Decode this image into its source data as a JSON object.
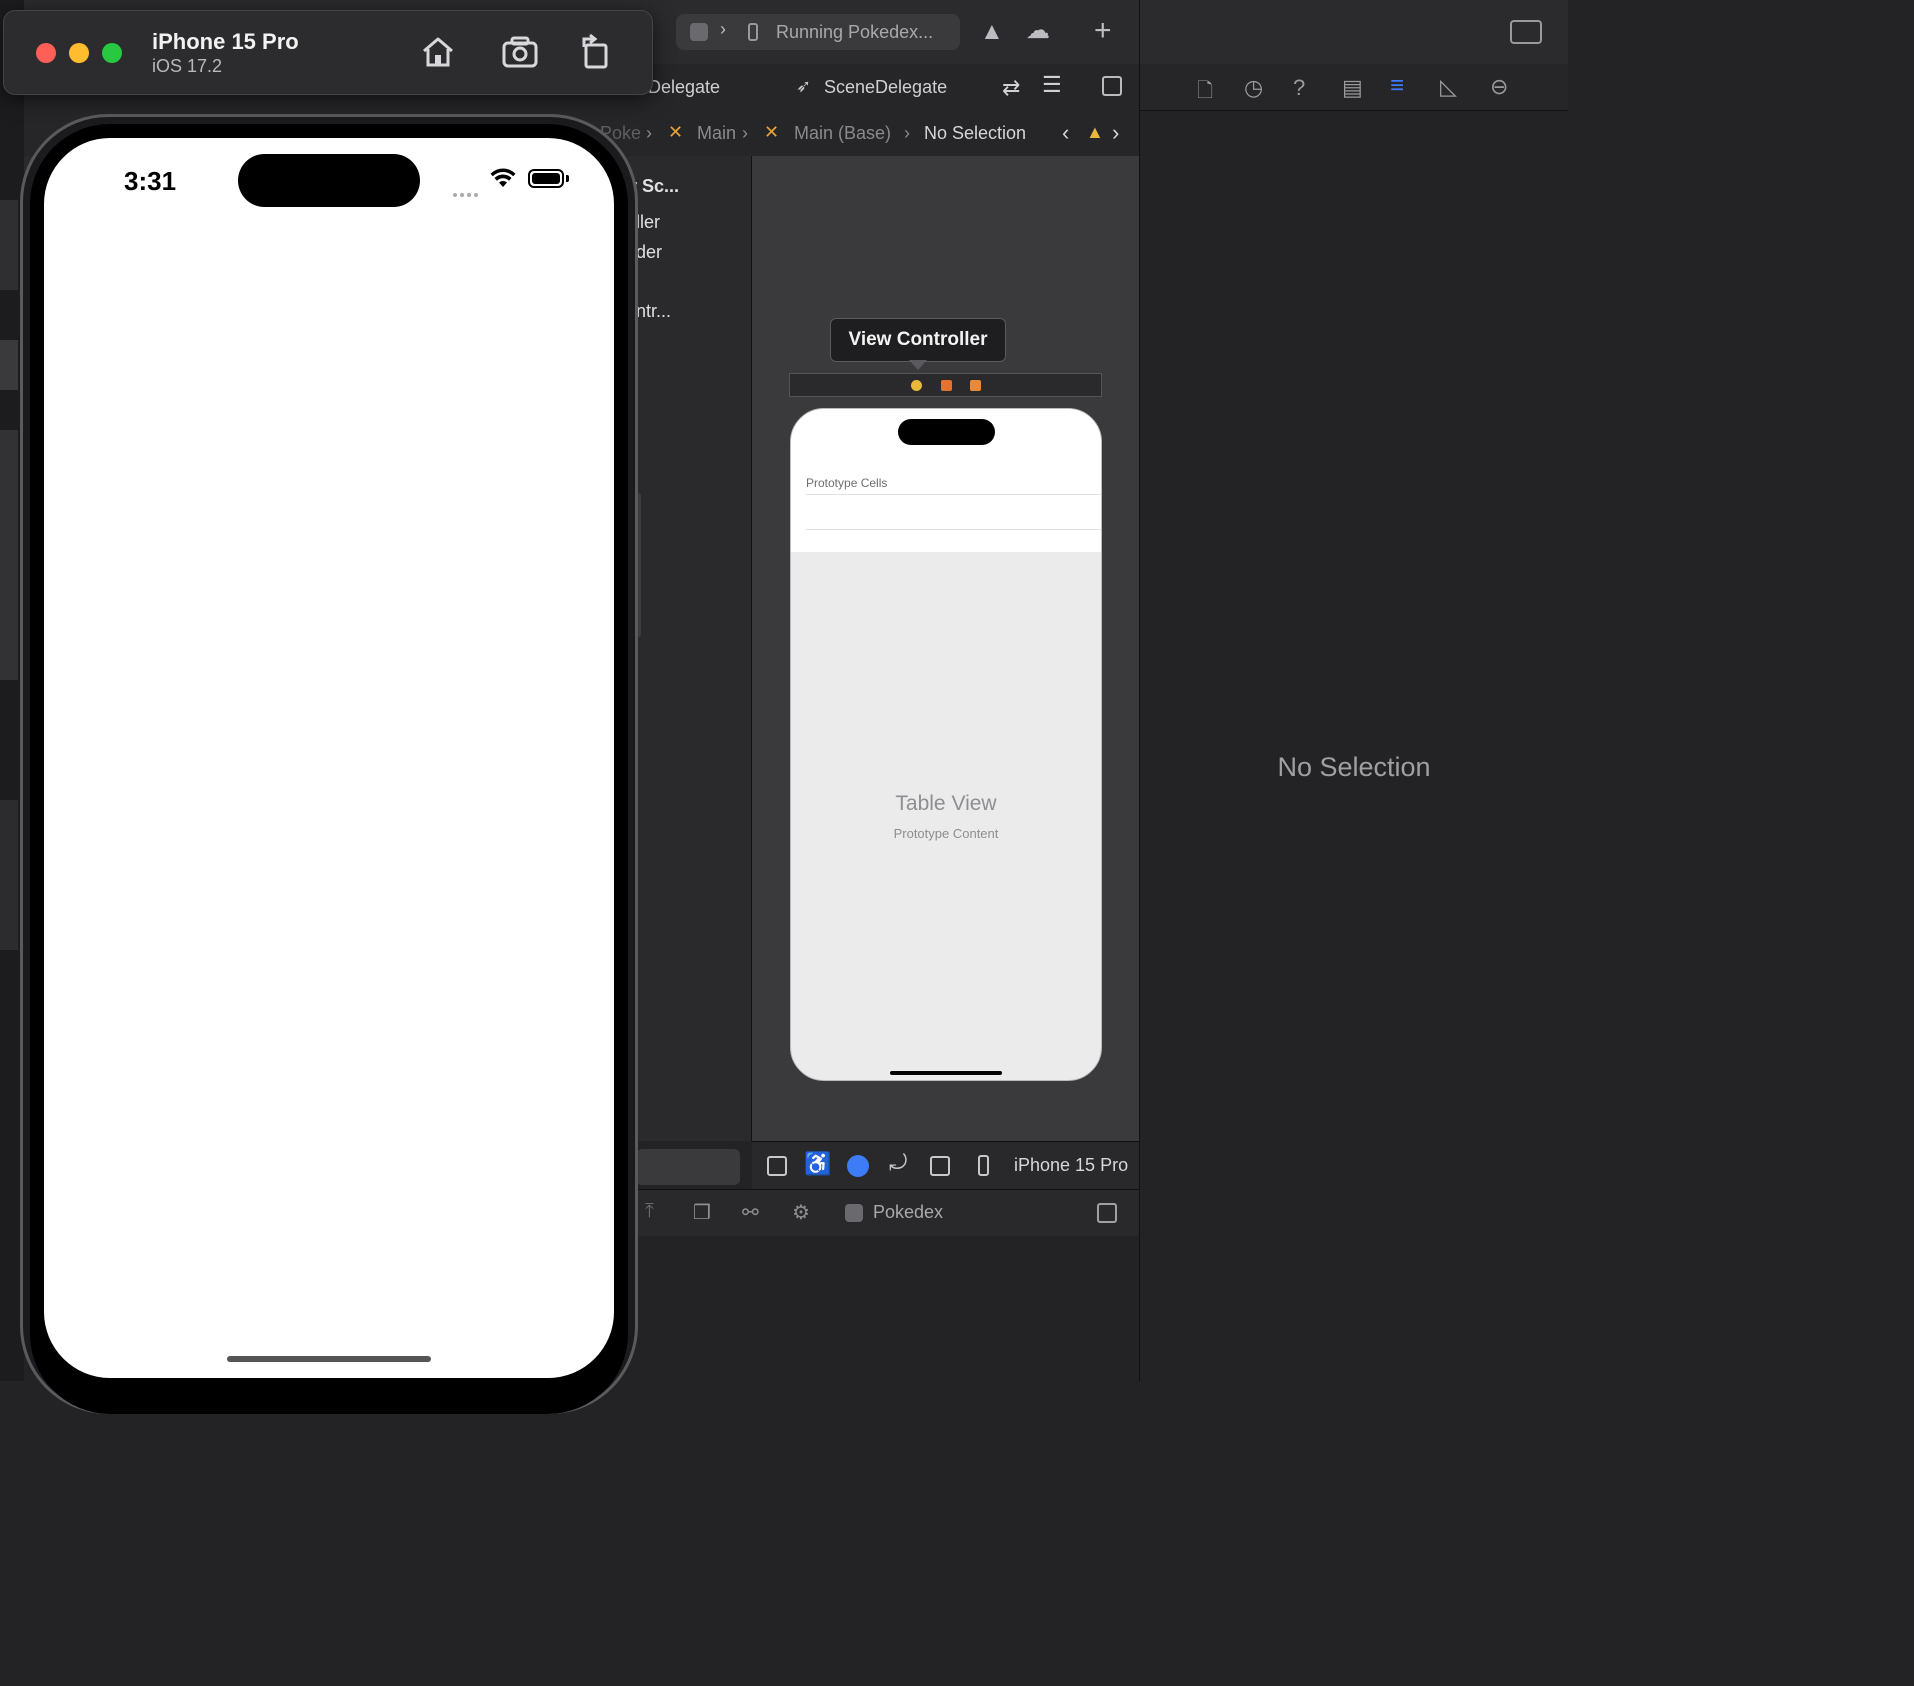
{
  "simulator": {
    "device_name": "iPhone 15 Pro",
    "os_version": "iOS 17.2",
    "status_time": "3:31"
  },
  "xcode": {
    "scheme_status": "Running Pokedex...",
    "tabs": [
      "Delegate",
      "SceneDelegate"
    ],
    "jumpbar": [
      "Poke",
      "Main",
      "Main (Base)",
      "No Selection"
    ],
    "outline_items": [
      "r Sc...",
      "ller",
      "der",
      "ntr..."
    ],
    "scene": {
      "label": "View Controller",
      "prototype_cells": "Prototype Cells",
      "table_view": "Table View",
      "prototype_content": "Prototype Content"
    },
    "canvas_device": "iPhone 15 Pro",
    "debug_target": "Pokedex",
    "inspector_empty": "No Selection"
  },
  "colors": {
    "close": "#ff5f57",
    "minimize": "#febc2e",
    "zoom": "#28c840",
    "accent": "#3d7bf7",
    "warning": "#e8a23a"
  }
}
